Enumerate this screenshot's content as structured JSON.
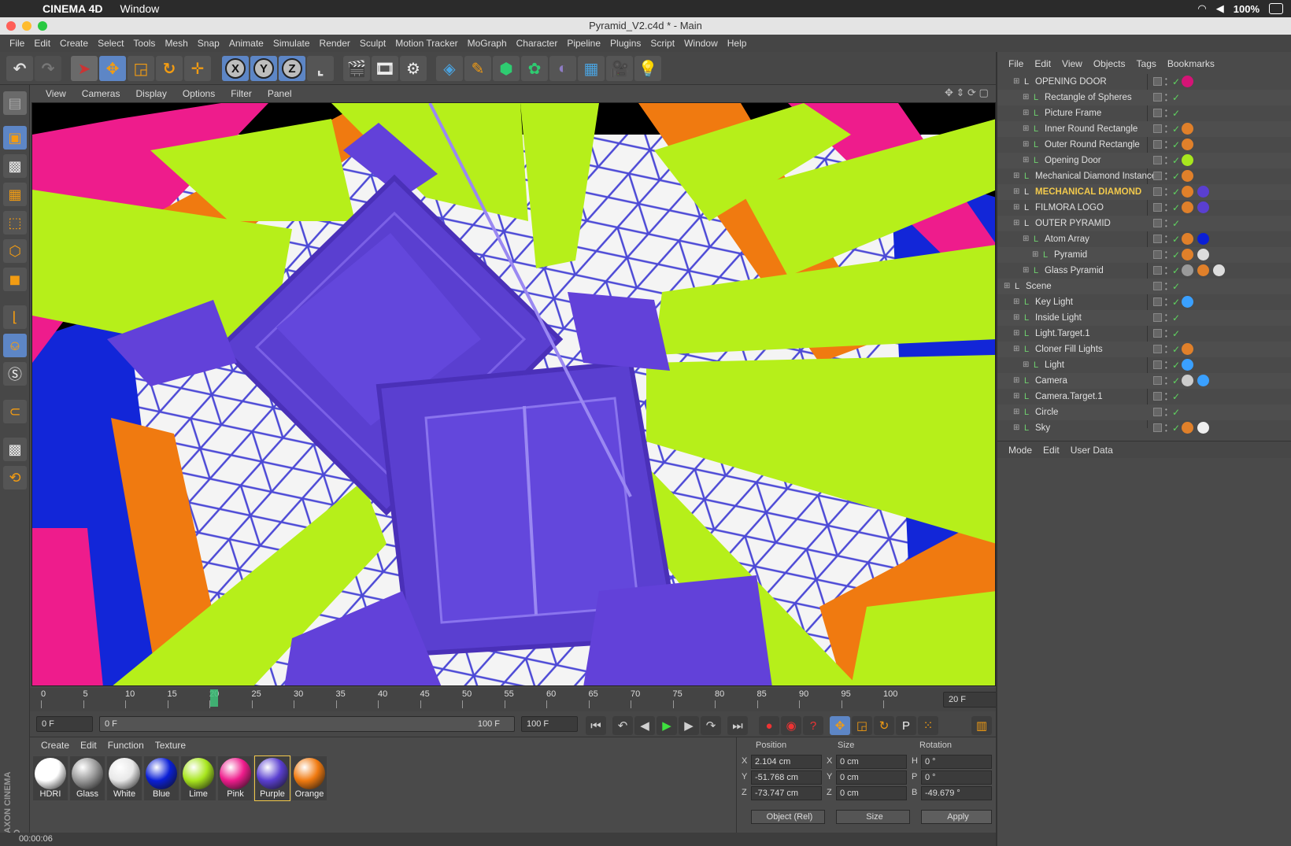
{
  "mac_menubar": {
    "app": "CINEMA 4D",
    "menu": "Window",
    "battery": "100%"
  },
  "window": {
    "title": "Pyramid_V2.c4d * - Main"
  },
  "app_menu": [
    "File",
    "Edit",
    "Create",
    "Select",
    "Tools",
    "Mesh",
    "Snap",
    "Animate",
    "Simulate",
    "Render",
    "Sculpt",
    "Motion Tracker",
    "MoGraph",
    "Character",
    "Pipeline",
    "Plugins",
    "Script",
    "Window",
    "Help"
  ],
  "toolbar": {
    "axes": [
      "X",
      "Y",
      "Z"
    ]
  },
  "viewport_menu": [
    "View",
    "Cameras",
    "Display",
    "Options",
    "Filter",
    "Panel"
  ],
  "timeline": {
    "ticks": [
      "0",
      "5",
      "10",
      "15",
      "20",
      "25",
      "30",
      "35",
      "40",
      "45",
      "50",
      "55",
      "60",
      "65",
      "70",
      "75",
      "80",
      "85",
      "90",
      "95",
      "100"
    ],
    "current_frame_display": "20 F",
    "start_field": "0 F",
    "range_start": "0 F",
    "range_end": "100 F",
    "end_field": "100 F"
  },
  "materials": {
    "menu": [
      "Create",
      "Edit",
      "Function",
      "Texture"
    ],
    "items": [
      {
        "name": "HDRI",
        "color": "#ffffff"
      },
      {
        "name": "Glass",
        "color": "#9a9a9a"
      },
      {
        "name": "White",
        "color": "#e8e8e8"
      },
      {
        "name": "Blue",
        "color": "#0a1fd6"
      },
      {
        "name": "Lime",
        "color": "#a8e61e"
      },
      {
        "name": "Pink",
        "color": "#ee1c8c"
      },
      {
        "name": "Purple",
        "color": "#5a3fd0"
      },
      {
        "name": "Orange",
        "color": "#f07a10"
      }
    ]
  },
  "coordinates": {
    "headers": {
      "position": "Position",
      "size": "Size",
      "rotation": "Rotation"
    },
    "rows": [
      {
        "axis": "X",
        "pos": "2.104 cm",
        "saxis": "X",
        "size": "0 cm",
        "raxis": "H",
        "rot": "0 °"
      },
      {
        "axis": "Y",
        "pos": "-51.768 cm",
        "saxis": "Y",
        "size": "0 cm",
        "raxis": "P",
        "rot": "0 °"
      },
      {
        "axis": "Z",
        "pos": "-73.747 cm",
        "saxis": "Z",
        "size": "0 cm",
        "raxis": "B",
        "rot": "-49.679 °"
      }
    ],
    "mode": "Object (Rel)",
    "size_mode": "Size",
    "apply": "Apply"
  },
  "status": {
    "time": "00:00:06"
  },
  "brand": "MAXON CINEMA 4D",
  "object_manager": {
    "menu": [
      "File",
      "Edit",
      "View",
      "Objects",
      "Tags",
      "Bookmarks"
    ],
    "objects": [
      {
        "name": "OPENING DOOR",
        "indent": 1,
        "highlight": false,
        "tags": [
          "#d41476"
        ]
      },
      {
        "name": "Rectangle of Spheres",
        "indent": 2,
        "highlight": false,
        "tags": []
      },
      {
        "name": "Picture Frame",
        "indent": 2,
        "highlight": false,
        "tags": []
      },
      {
        "name": "Inner Round Rectangle",
        "indent": 2,
        "highlight": false,
        "tags": [
          "#e0802a"
        ]
      },
      {
        "name": "Outer Round Rectangle",
        "indent": 2,
        "highlight": false,
        "tags": [
          "#e0802a"
        ]
      },
      {
        "name": "Opening Door",
        "indent": 2,
        "highlight": false,
        "tags": [
          "#a8e61e"
        ]
      },
      {
        "name": "Mechanical Diamond Instance",
        "indent": 1,
        "highlight": false,
        "tags": [
          "#e0802a"
        ]
      },
      {
        "name": "MECHANICAL DIAMOND",
        "indent": 1,
        "highlight": true,
        "tags": [
          "#e0802a",
          "#5a3fd0"
        ]
      },
      {
        "name": "FILMORA LOGO",
        "indent": 1,
        "highlight": false,
        "tags": [
          "#e0802a",
          "#5a3fd0"
        ]
      },
      {
        "name": "OUTER PYRAMID",
        "indent": 1,
        "highlight": false,
        "tags": []
      },
      {
        "name": "Atom Array",
        "indent": 2,
        "highlight": false,
        "tags": [
          "#e0802a",
          "#0a1fd6"
        ]
      },
      {
        "name": "Pyramid",
        "indent": 3,
        "highlight": false,
        "tags": [
          "#e0802a",
          "#dddddd"
        ]
      },
      {
        "name": "Glass Pyramid",
        "indent": 2,
        "highlight": false,
        "tags": [
          "#9a9a9a",
          "#e0802a",
          "#dddddd"
        ]
      },
      {
        "name": "Scene",
        "indent": 0,
        "highlight": false,
        "tags": []
      },
      {
        "name": "Key Light",
        "indent": 1,
        "highlight": false,
        "tags": [
          "#3aa0ff"
        ]
      },
      {
        "name": "Inside Light",
        "indent": 1,
        "highlight": false,
        "tags": []
      },
      {
        "name": "Light.Target.1",
        "indent": 1,
        "highlight": false,
        "tags": []
      },
      {
        "name": "Cloner Fill Lights",
        "indent": 1,
        "highlight": false,
        "tags": [
          "#e0802a"
        ]
      },
      {
        "name": "Light",
        "indent": 2,
        "highlight": false,
        "tags": [
          "#3aa0ff"
        ]
      },
      {
        "name": "Camera",
        "indent": 1,
        "highlight": false,
        "tags": [
          "#cccccc",
          "#3aa0ff"
        ]
      },
      {
        "name": "Camera.Target.1",
        "indent": 1,
        "highlight": false,
        "tags": []
      },
      {
        "name": "Circle",
        "indent": 1,
        "highlight": false,
        "tags": []
      },
      {
        "name": "Sky",
        "indent": 1,
        "highlight": false,
        "tags": [
          "#e0802a",
          "#eeeeee"
        ]
      }
    ]
  },
  "attribute_manager": {
    "menu": [
      "Mode",
      "Edit",
      "User Data"
    ]
  }
}
